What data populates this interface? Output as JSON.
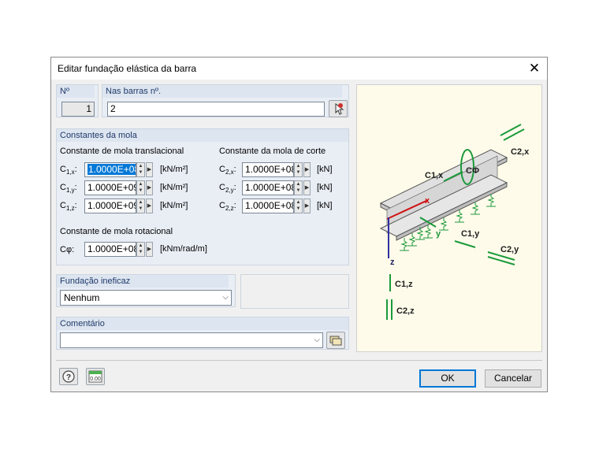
{
  "dialog": {
    "title": "Editar fundação elástica da barra",
    "close_glyph": "✕"
  },
  "number": {
    "label": "Nº",
    "value": "1"
  },
  "members": {
    "label": "Nas barras nº.",
    "value": "2",
    "pick_icon": "pick-members-icon"
  },
  "spring_constants": {
    "header": "Constantes da mola",
    "translational": {
      "title": "Constante de mola translacional",
      "rows": [
        {
          "symbol": "C",
          "sub": "1,x",
          "value_hl": "1.0000E+08",
          "value": "1.0000E+08",
          "unit": "[kN/m²]"
        },
        {
          "symbol": "C",
          "sub": "1,y",
          "value": "1.0000E+09",
          "unit": "[kN/m²]"
        },
        {
          "symbol": "C",
          "sub": "1,z",
          "value": "1.0000E+09",
          "unit": "[kN/m²]"
        }
      ]
    },
    "shear": {
      "title": "Constante da mola de corte",
      "rows": [
        {
          "symbol": "C",
          "sub": "2,x",
          "value": "1.0000E+08",
          "unit": "[kN]"
        },
        {
          "symbol": "C",
          "sub": "2,y",
          "value": "1.0000E+08",
          "unit": "[kN]"
        },
        {
          "symbol": "C",
          "sub": "2,z",
          "value": "1.0000E+08",
          "unit": "[kN]"
        }
      ]
    },
    "rotational": {
      "title": "Constante de mola rotacional",
      "symbol": "Cφ:",
      "value": "1.0000E+08",
      "unit": "[kNm/rad/m]"
    }
  },
  "ineffective": {
    "header": "Fundação ineficaz",
    "selected": "Nenhum"
  },
  "comment": {
    "header": "Comentário",
    "value": ""
  },
  "preview": {
    "labels": {
      "c2x": "C2,x",
      "c1x": "C1,x",
      "cphi": "CΦ",
      "x": "x",
      "y": "y",
      "z": "z",
      "c1y": "C1,y",
      "c2y": "C2,y",
      "c1z": "C1,z",
      "c2z": "C2,z"
    }
  },
  "footer": {
    "ok": "OK",
    "cancel": "Cancelar"
  },
  "colors": {
    "accent": "#0078d7",
    "section_header": "#1f3a6a",
    "spring_green": "#1a9a3a",
    "axis_red": "#d01010"
  }
}
